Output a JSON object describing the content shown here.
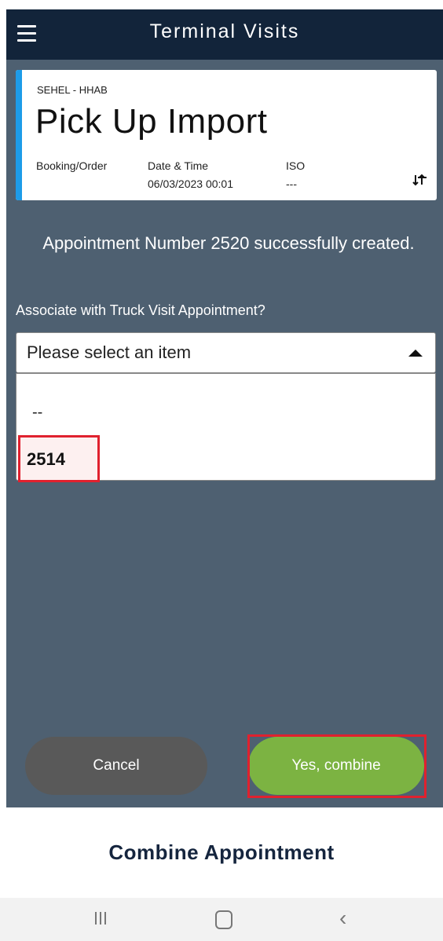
{
  "header": {
    "title": "Terminal Visits",
    "menu_icon": "hamburger-menu-icon"
  },
  "card": {
    "subtitle": "SEHEL - HHAB",
    "title": "Pick Up Import",
    "accent_color": "#1d9be8",
    "fields": [
      {
        "label": "Booking/Order",
        "value": ""
      },
      {
        "label": "Date & Time",
        "value": "06/03/2023 00:01"
      },
      {
        "label": "ISO",
        "value": "---"
      }
    ],
    "action_icon": "swap-arrows-icon"
  },
  "message": "Appointment Number 2520 successfully created.",
  "association": {
    "label": "Associate with Truck Visit Appointment?",
    "select": {
      "placeholder": "Please select an item",
      "options": [
        "--",
        "2514"
      ]
    }
  },
  "buttons": {
    "cancel": "Cancel",
    "confirm": "Yes, combine"
  },
  "bottom_title": "Combine Appointment",
  "system_nav": {
    "recent": "recent-apps-icon",
    "home": "home-icon",
    "back": "back-icon"
  },
  "colors": {
    "header_bg": "#12243a",
    "body_bg": "#4e6071",
    "confirm_btn": "#7cb342",
    "cancel_btn": "#595959",
    "highlight": "#e0212e"
  }
}
